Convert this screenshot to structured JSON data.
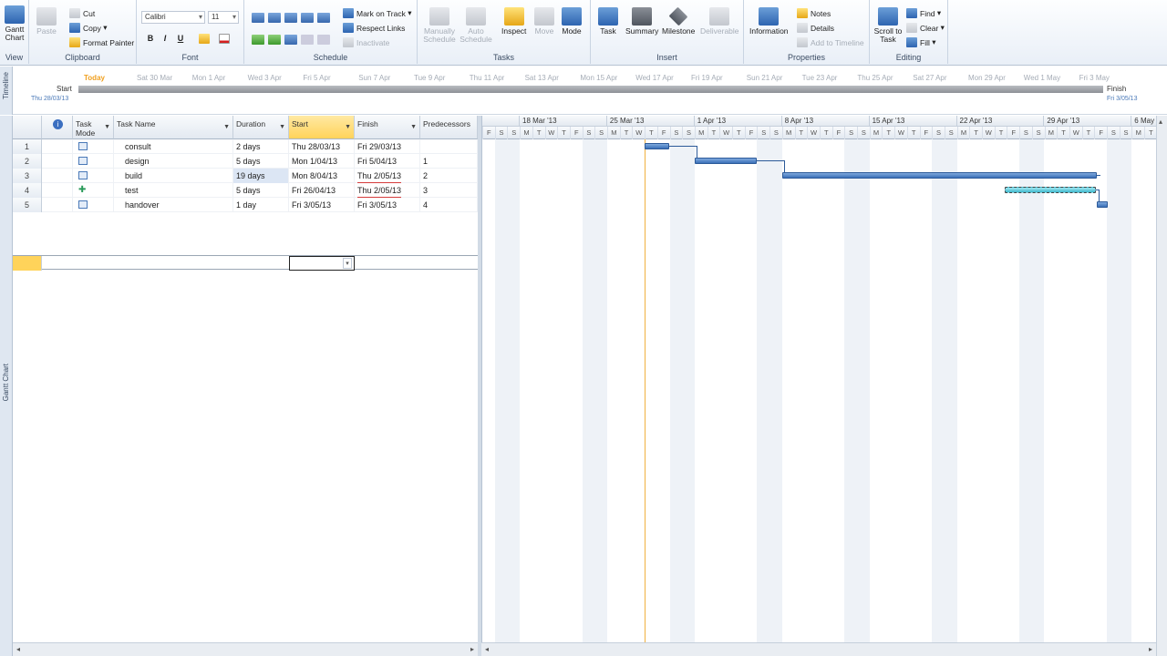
{
  "ribbon": {
    "view": {
      "gantt_chart": "Gantt Chart",
      "label": "View"
    },
    "clipboard": {
      "paste": "Paste",
      "cut": "Cut",
      "copy": "Copy",
      "format_painter": "Format Painter",
      "label": "Clipboard"
    },
    "font": {
      "family": "Calibri",
      "size": "11",
      "bold": "B",
      "italic": "I",
      "underline": "U",
      "label": "Font"
    },
    "schedule": {
      "mark_on_track": "Mark on Track",
      "respect_links": "Respect Links",
      "inactivate": "Inactivate",
      "label": "Schedule"
    },
    "tasks": {
      "manually_schedule": "Manually Schedule",
      "auto_schedule": "Auto Schedule",
      "inspect": "Inspect",
      "move": "Move",
      "mode": "Mode",
      "label": "Tasks"
    },
    "insert": {
      "task": "Task",
      "summary": "Summary",
      "milestone": "Milestone",
      "deliverable": "Deliverable",
      "label": "Insert"
    },
    "properties": {
      "information": "Information",
      "notes": "Notes",
      "details": "Details",
      "add_to_timeline": "Add to Timeline",
      "label": "Properties"
    },
    "editing": {
      "scroll_to_task": "Scroll to Task",
      "find": "Find",
      "clear": "Clear",
      "fill": "Fill",
      "label": "Editing"
    }
  },
  "timeline": {
    "side_label": "Timeline",
    "start_label": "Start",
    "start_date": "Thu 28/03/13",
    "finish_label": "Finish",
    "finish_date": "Fri 3/05/13",
    "today": "Today",
    "dates": [
      "Sat 30 Mar",
      "Mon 1 Apr",
      "Wed 3 Apr",
      "Fri 5 Apr",
      "Sun 7 Apr",
      "Tue 9 Apr",
      "Thu 11 Apr",
      "Sat 13 Apr",
      "Mon 15 Apr",
      "Wed 17 Apr",
      "Fri 19 Apr",
      "Sun 21 Apr",
      "Tue 23 Apr",
      "Thu 25 Apr",
      "Sat 27 Apr",
      "Mon 29 Apr",
      "Wed 1 May",
      "Fri 3 May"
    ]
  },
  "viewbar": {
    "label": "Gantt Chart"
  },
  "grid": {
    "headers": {
      "task_mode": "Task Mode",
      "task_name": "Task Name",
      "duration": "Duration",
      "start": "Start",
      "finish": "Finish",
      "predecessors": "Predecessors"
    },
    "rows": [
      {
        "id": "1",
        "mode": "auto",
        "name": "consult",
        "duration": "2 days",
        "start": "Thu 28/03/13",
        "finish": "Fri 29/03/13",
        "pred": ""
      },
      {
        "id": "2",
        "mode": "auto",
        "name": "design",
        "duration": "5 days",
        "start": "Mon 1/04/13",
        "finish": "Fri 5/04/13",
        "pred": "1"
      },
      {
        "id": "3",
        "mode": "auto",
        "name": "build",
        "duration": "19 days",
        "start": "Mon 8/04/13",
        "finish": "Thu 2/05/13",
        "pred": "2"
      },
      {
        "id": "4",
        "mode": "manual",
        "name": "test",
        "duration": "5 days",
        "start": "Fri 26/04/13",
        "finish": "Thu 2/05/13",
        "pred": "3"
      },
      {
        "id": "5",
        "mode": "auto",
        "name": "handover",
        "duration": "1 day",
        "start": "Fri 3/05/13",
        "finish": "Fri 3/05/13",
        "pred": "4"
      }
    ]
  },
  "gantt": {
    "weeks": [
      "18 Mar '13",
      "25 Mar '13",
      "1 Apr '13",
      "8 Apr '13",
      "15 Apr '13",
      "22 Apr '13",
      "29 Apr '13",
      "6 May"
    ],
    "day_letters": [
      "F",
      "S",
      "S",
      "M",
      "T",
      "W",
      "T",
      "F",
      "S",
      "S",
      "M",
      "T",
      "W",
      "T",
      "F",
      "S",
      "S",
      "M",
      "T",
      "W",
      "T",
      "F",
      "S",
      "S",
      "M",
      "T",
      "W",
      "T",
      "F",
      "S",
      "S",
      "M",
      "T",
      "W",
      "T",
      "F",
      "S",
      "S",
      "M",
      "T",
      "W",
      "T",
      "F",
      "S",
      "S",
      "M",
      "T",
      "W",
      "T",
      "F",
      "S",
      "S",
      "M",
      "T"
    ]
  },
  "colors": {
    "accent": "#3a6fb7",
    "selected_column": "#ffd35a",
    "today_line": "#f0b040"
  }
}
